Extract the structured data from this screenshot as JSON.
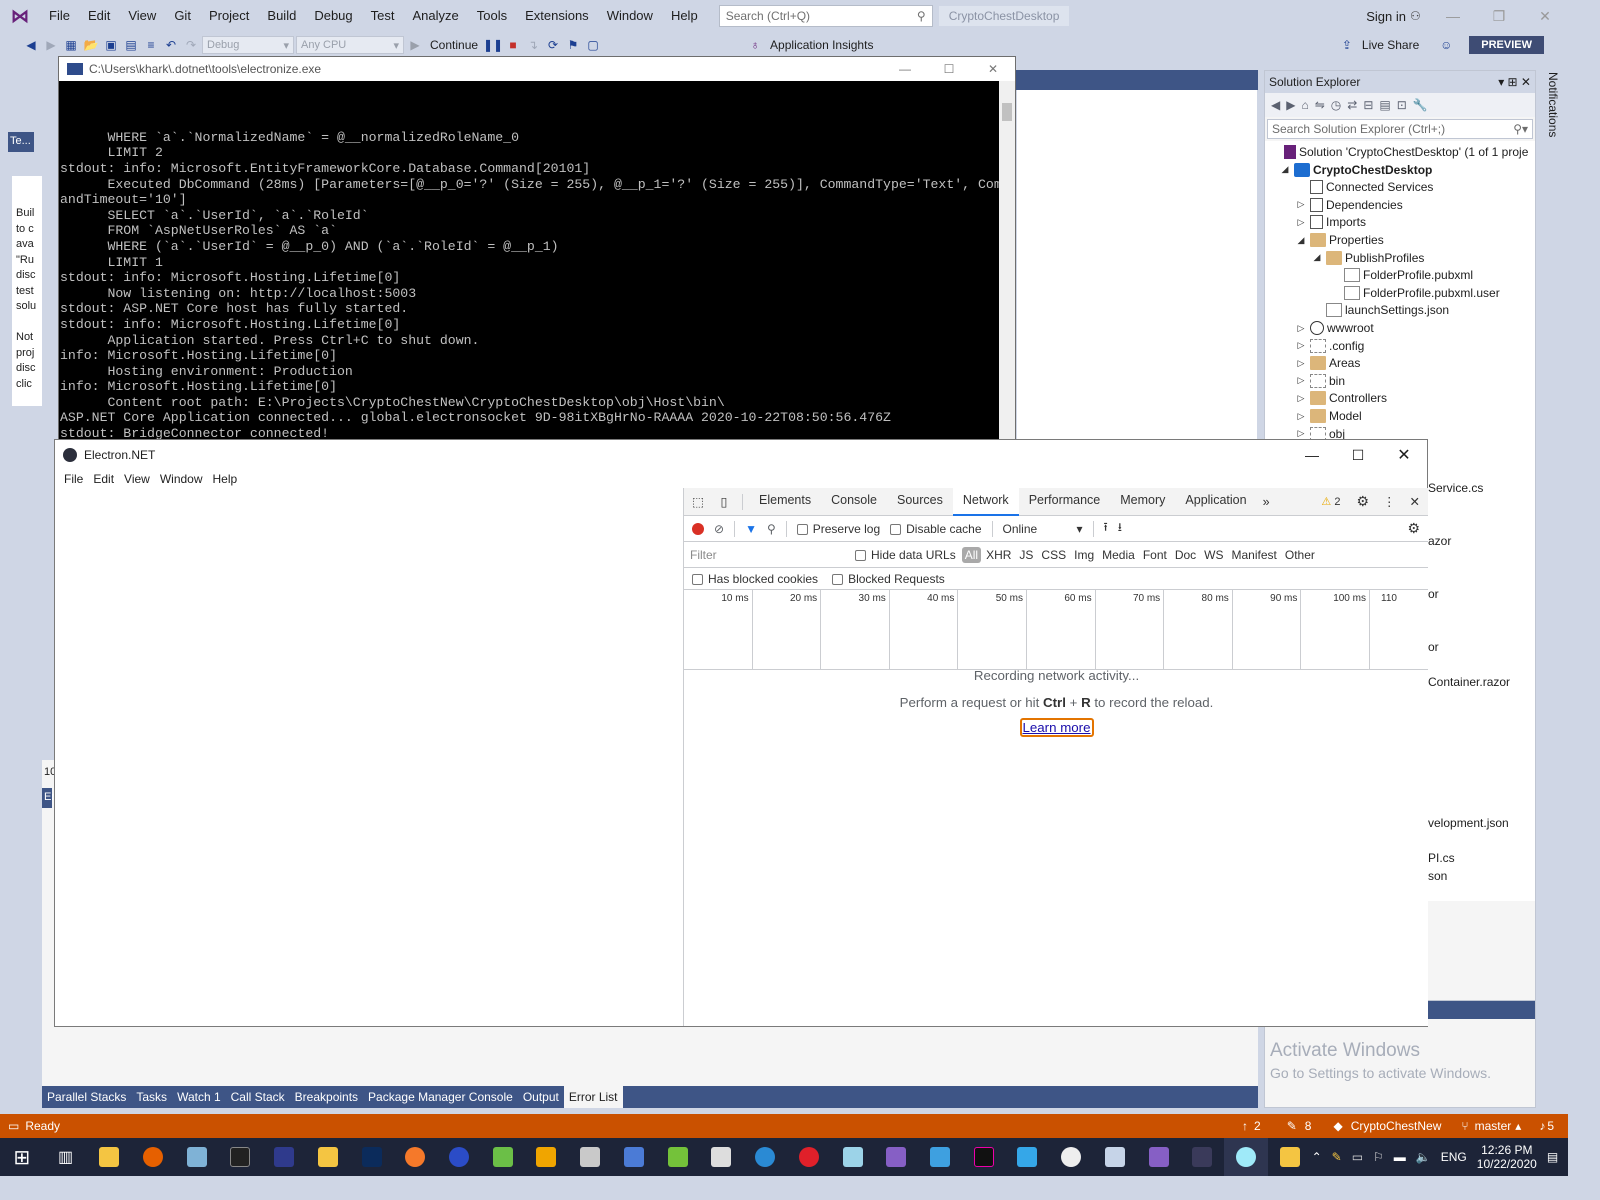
{
  "vs": {
    "menu": [
      "File",
      "Edit",
      "View",
      "Git",
      "Project",
      "Build",
      "Debug",
      "Test",
      "Analyze",
      "Tools",
      "Extensions",
      "Window",
      "Help"
    ],
    "search_placeholder": "Search (Ctrl+Q)",
    "solution_name": "CryptoChestDesktop",
    "sign_in": "Sign in",
    "toolbar": {
      "config": "Debug",
      "platform": "Any CPU",
      "continue": "Continue",
      "app_insights": "Application Insights",
      "live_share": "Live Share",
      "preview": "PREVIEW"
    },
    "left_tab": "Te...",
    "left_strip_text": "Buil\nto c\nava\n\"Ru\ndisc\ntest\nsolu\n\nNot\nproj\ndisc\nclic",
    "left_number": "10",
    "left_er": "Er",
    "bottom_tabs": [
      "Parallel Stacks",
      "Tasks",
      "Watch 1",
      "Call Stack",
      "Breakpoints",
      "Package Manager Console",
      "Output",
      "Error List"
    ],
    "notifications": "Notifications"
  },
  "solution_explorer": {
    "title": "Solution Explorer",
    "search_placeholder": "Search Solution Explorer (Ctrl+;)",
    "items": [
      {
        "label": "Solution 'CryptoChestDesktop' (1 of 1 proje",
        "bold": false
      },
      {
        "label": "CryptoChestDesktop",
        "bold": true
      },
      {
        "label": "Connected Services"
      },
      {
        "label": "Dependencies"
      },
      {
        "label": "Imports"
      },
      {
        "label": "Properties"
      },
      {
        "label": "PublishProfiles"
      },
      {
        "label": "FolderProfile.pubxml"
      },
      {
        "label": "FolderProfile.pubxml.user"
      },
      {
        "label": "launchSettings.json"
      },
      {
        "label": "wwwroot"
      },
      {
        "label": ".config"
      },
      {
        "label": "Areas"
      },
      {
        "label": "bin"
      },
      {
        "label": "Controllers"
      },
      {
        "label": "Model"
      },
      {
        "label": "obj"
      }
    ],
    "clipped": [
      "Service.cs",
      "azor",
      "or",
      "or",
      "Container.razor",
      "velopment.json",
      "PI.cs",
      "son"
    ]
  },
  "watermark": {
    "line1": "Activate Windows",
    "line2": "Go to Settings to activate Windows."
  },
  "console": {
    "title": "C:\\Users\\khark\\.dotnet\\tools\\electronize.exe",
    "lines": [
      "      WHERE `a`.`NormalizedName` = @__normalizedRoleName_0",
      "      LIMIT 2",
      "stdout: info: Microsoft.EntityFrameworkCore.Database.Command[20101]",
      "      Executed DbCommand (28ms) [Parameters=[@__p_0='?' (Size = 255), @__p_1='?' (Size = 255)], CommandType='Text', Comm",
      "andTimeout='10']",
      "      SELECT `a`.`UserId`, `a`.`RoleId`",
      "      FROM `AspNetUserRoles` AS `a`",
      "      WHERE (`a`.`UserId` = @__p_0) AND (`a`.`RoleId` = @__p_1)",
      "      LIMIT 1",
      "stdout: info: Microsoft.Hosting.Lifetime[0]",
      "      Now listening on: http://localhost:5003",
      "stdout: ASP.NET Core host has fully started.",
      "stdout: info: Microsoft.Hosting.Lifetime[0]",
      "      Application started. Press Ctrl+C to shut down.",
      "info: Microsoft.Hosting.Lifetime[0]",
      "      Hosting environment: Production",
      "info: Microsoft.Hosting.Lifetime[0]",
      "      Content root path: E:\\Projects\\CryptoChestNew\\CryptoChestDesktop\\obj\\Host\\bin\\",
      "ASP.NET Core Application connected... global.electronsocket 9D-98itXBgHrNo-RAAAA 2020-10-22T08:50:56.476Z",
      "stdout: BridgeConnector connected!"
    ]
  },
  "electron": {
    "title": "Electron.NET",
    "menu": [
      "File",
      "Edit",
      "View",
      "Window",
      "Help"
    ]
  },
  "devtools": {
    "tabs": [
      "Elements",
      "Console",
      "Sources",
      "Network",
      "Performance",
      "Memory",
      "Application"
    ],
    "active_tab": "Network",
    "warnings": "2",
    "preserve_log": "Preserve log",
    "disable_cache": "Disable cache",
    "throttle": "Online",
    "filter_placeholder": "Filter",
    "hide_data_urls": "Hide data URLs",
    "types": [
      "All",
      "XHR",
      "JS",
      "CSS",
      "Img",
      "Media",
      "Font",
      "Doc",
      "WS",
      "Manifest",
      "Other"
    ],
    "has_blocked_cookies": "Has blocked cookies",
    "blocked_requests": "Blocked Requests",
    "ticks": [
      "10 ms",
      "20 ms",
      "30 ms",
      "40 ms",
      "50 ms",
      "60 ms",
      "70 ms",
      "80 ms",
      "90 ms",
      "100 ms",
      "110"
    ],
    "recording": "Recording network activity...",
    "perform_pre": "Perform a request or hit ",
    "perform_key1": "Ctrl",
    "perform_plus": " + ",
    "perform_key2": "R",
    "perform_post": " to record the reload.",
    "learn_more": "Learn more"
  },
  "status": {
    "ready": "Ready",
    "up_count": "2",
    "edit_count": "8",
    "repo": "CryptoChestNew",
    "branch": "master",
    "notif_count": "5"
  },
  "taskbar": {
    "time": "12:26 PM",
    "date": "10/22/2020",
    "lang": "ENG"
  },
  "colors": {
    "vs_bg": "#cfd6e5",
    "vs_blue": "#3e5586",
    "status_orange": "#ca5100",
    "taskbar": "#1d2438",
    "devtools_accent": "#1a73e8"
  }
}
